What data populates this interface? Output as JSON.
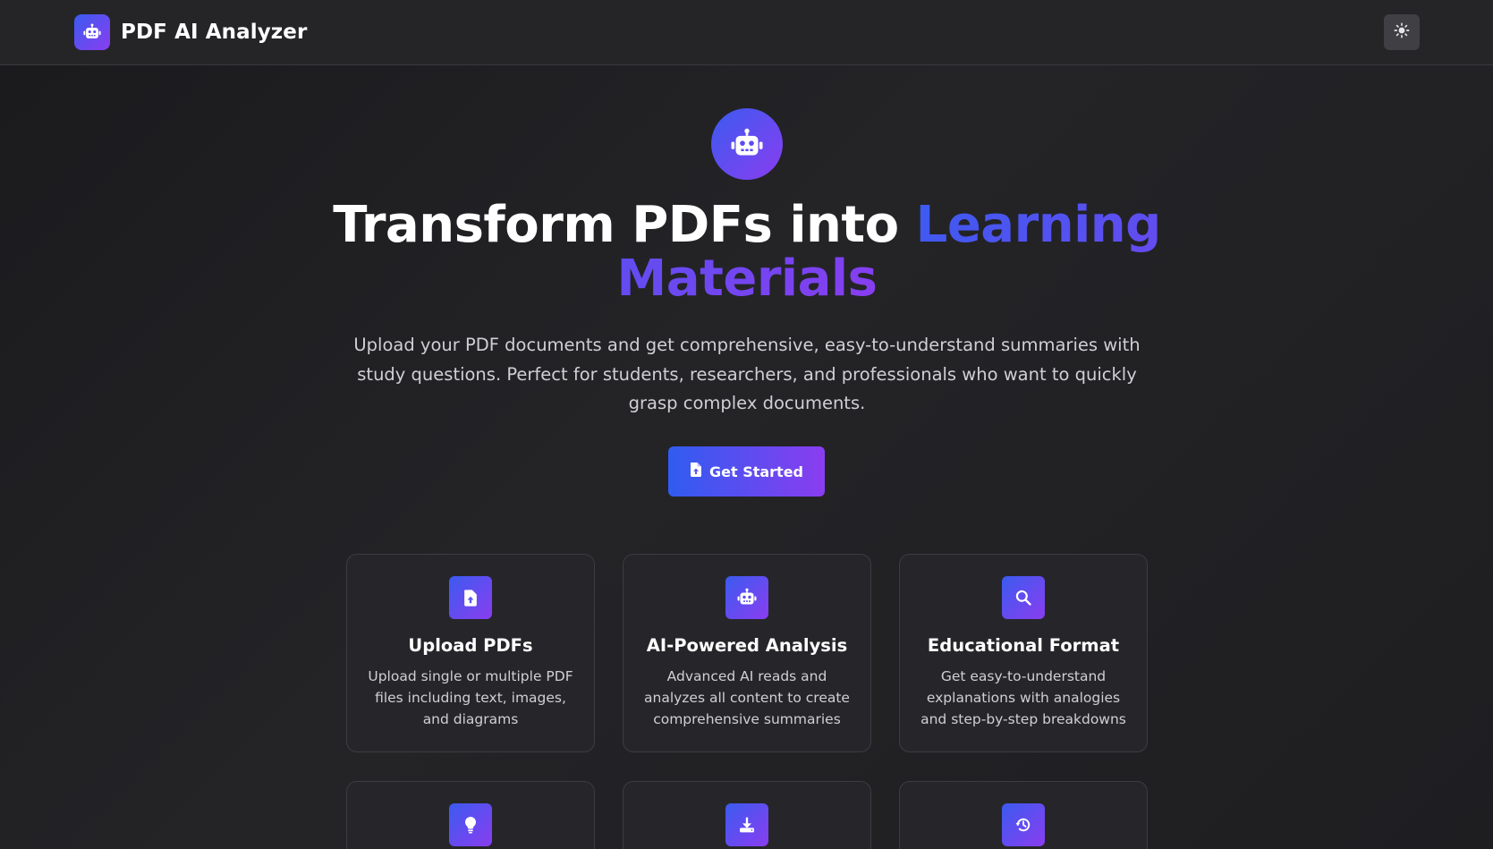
{
  "header": {
    "app_name": "PDF AI Analyzer",
    "logo_icon": "robot-icon",
    "theme_toggle_icon": "sun-icon"
  },
  "hero": {
    "icon": "robot-icon",
    "title_plain": "Transform PDFs into ",
    "title_accent": "Learning Materials",
    "subtitle": "Upload your PDF documents and get comprehensive, easy-to-understand summaries with study questions. Perfect for students, researchers, and professionals who want to quickly grasp complex documents.",
    "cta_label": "Get Started",
    "cta_icon": "file-upload-icon"
  },
  "features": [
    {
      "icon": "file-upload-icon",
      "title": "Upload PDFs",
      "description": "Upload single or multiple PDF files including text, images, and diagrams"
    },
    {
      "icon": "robot-icon",
      "title": "AI-Powered Analysis",
      "description": "Advanced AI reads and analyzes all content to create comprehensive summaries"
    },
    {
      "icon": "search-icon",
      "title": "Educational Format",
      "description": "Get easy-to-understand explanations with analogies and step-by-step breakdowns"
    },
    {
      "icon": "lightbulb-icon"
    },
    {
      "icon": "download-icon"
    },
    {
      "icon": "history-icon"
    }
  ],
  "colors": {
    "accent_start": "#3b5bf0",
    "accent_end": "#8a3df0",
    "background": "#1e1e21",
    "card_background": "#26262a"
  }
}
